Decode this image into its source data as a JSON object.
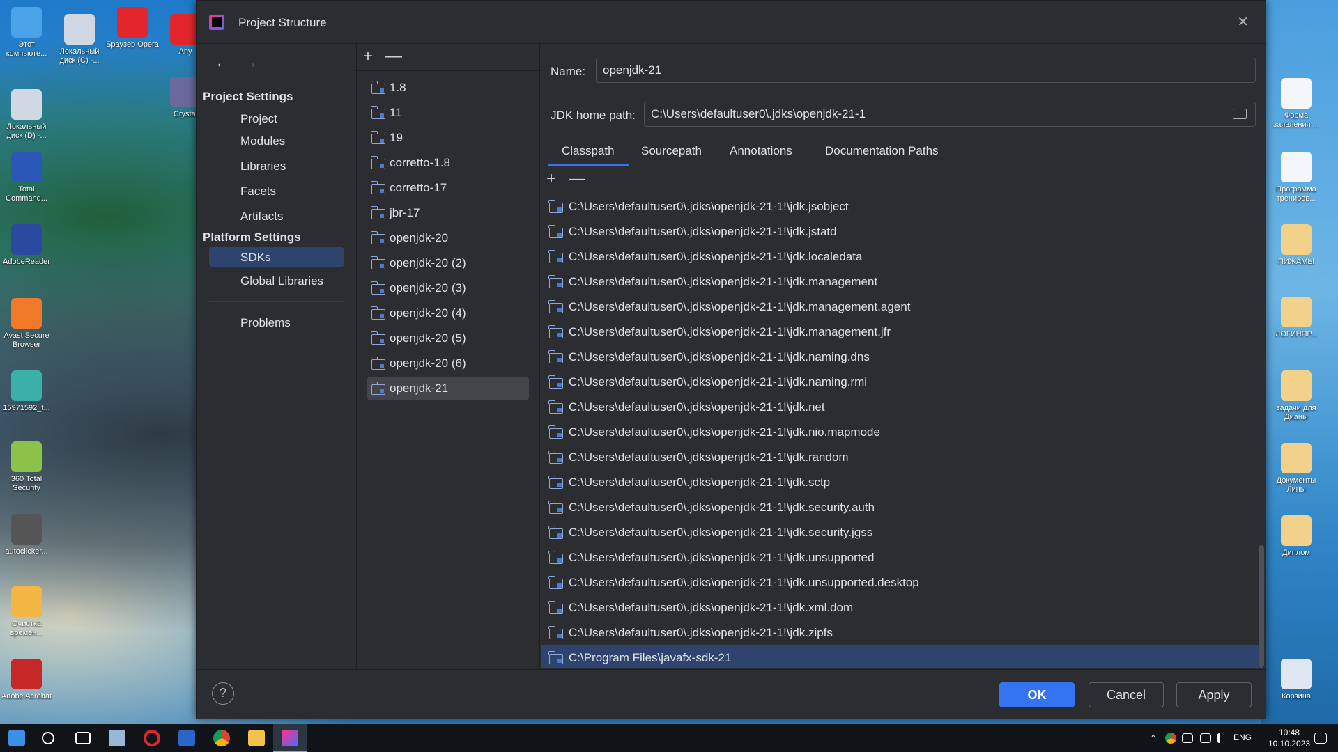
{
  "desktop": {
    "left_icons": [
      {
        "label": "Этот компьюте..."
      },
      {
        "label": "Локальный диск (C) -..."
      },
      {
        "label": "Браузер Opera"
      },
      {
        "label": "Any"
      },
      {
        "label": "Локальный диск (D) -..."
      },
      {
        "label": "Crystal"
      },
      {
        "label": "Total Command..."
      },
      {
        "label": "AdobeReader"
      },
      {
        "label": "Avast Secure Browser"
      },
      {
        "label": "15971592_t..."
      },
      {
        "label": "360 Total Security"
      },
      {
        "label": "autoclicker..."
      },
      {
        "label": "Очистка времен..."
      },
      {
        "label": "Adobe Acrobat"
      }
    ],
    "right_icons": [
      {
        "label": "Форма заявления ..."
      },
      {
        "label": "Программа трениров..."
      },
      {
        "label": "ПИЖАМЫ"
      },
      {
        "label": "ЛОГИНПР..."
      },
      {
        "label": "задачи для Дианы"
      },
      {
        "label": "Документы Лины"
      },
      {
        "label": "Диплом"
      },
      {
        "label": "Корзина"
      }
    ]
  },
  "window": {
    "title": "Project Structure",
    "close_glyph": "✕"
  },
  "nav": {
    "back_glyph": "←",
    "forward_glyph": "→",
    "project_settings_header": "Project Settings",
    "project_items": [
      "Project",
      "Modules",
      "Libraries",
      "Facets",
      "Artifacts"
    ],
    "platform_settings_header": "Platform Settings",
    "platform_items": [
      "SDKs",
      "Global Libraries"
    ],
    "problems": "Problems",
    "selected": "SDKs"
  },
  "sdks": {
    "add_glyph": "+",
    "remove_glyph": "—",
    "items": [
      "1.8",
      "11",
      "19",
      "corretto-1.8",
      "corretto-17",
      "jbr-17",
      "openjdk-20",
      "openjdk-20 (2)",
      "openjdk-20 (3)",
      "openjdk-20 (4)",
      "openjdk-20 (5)",
      "openjdk-20 (6)",
      "openjdk-21"
    ],
    "selected": "openjdk-21"
  },
  "detail": {
    "name_label": "Name:",
    "name_value": "openjdk-21",
    "home_label": "JDK home path:",
    "home_value": "C:\\Users\\defaultuser0\\.jdks\\openjdk-21-1",
    "tabs": [
      "Classpath",
      "Sourcepath",
      "Annotations",
      "Documentation Paths"
    ],
    "active_tab": "Classpath",
    "add_glyph": "+",
    "remove_glyph": "—",
    "paths": [
      "C:\\Users\\defaultuser0\\.jdks\\openjdk-21-1!\\jdk.jsobject",
      "C:\\Users\\defaultuser0\\.jdks\\openjdk-21-1!\\jdk.jstatd",
      "C:\\Users\\defaultuser0\\.jdks\\openjdk-21-1!\\jdk.localedata",
      "C:\\Users\\defaultuser0\\.jdks\\openjdk-21-1!\\jdk.management",
      "C:\\Users\\defaultuser0\\.jdks\\openjdk-21-1!\\jdk.management.agent",
      "C:\\Users\\defaultuser0\\.jdks\\openjdk-21-1!\\jdk.management.jfr",
      "C:\\Users\\defaultuser0\\.jdks\\openjdk-21-1!\\jdk.naming.dns",
      "C:\\Users\\defaultuser0\\.jdks\\openjdk-21-1!\\jdk.naming.rmi",
      "C:\\Users\\defaultuser0\\.jdks\\openjdk-21-1!\\jdk.net",
      "C:\\Users\\defaultuser0\\.jdks\\openjdk-21-1!\\jdk.nio.mapmode",
      "C:\\Users\\defaultuser0\\.jdks\\openjdk-21-1!\\jdk.random",
      "C:\\Users\\defaultuser0\\.jdks\\openjdk-21-1!\\jdk.sctp",
      "C:\\Users\\defaultuser0\\.jdks\\openjdk-21-1!\\jdk.security.auth",
      "C:\\Users\\defaultuser0\\.jdks\\openjdk-21-1!\\jdk.security.jgss",
      "C:\\Users\\defaultuser0\\.jdks\\openjdk-21-1!\\jdk.unsupported",
      "C:\\Users\\defaultuser0\\.jdks\\openjdk-21-1!\\jdk.unsupported.desktop",
      "C:\\Users\\defaultuser0\\.jdks\\openjdk-21-1!\\jdk.xml.dom",
      "C:\\Users\\defaultuser0\\.jdks\\openjdk-21-1!\\jdk.zipfs",
      "C:\\Program Files\\javafx-sdk-21"
    ],
    "selected_path": "C:\\Program Files\\javafx-sdk-21"
  },
  "footer": {
    "help_glyph": "?",
    "ok": "OK",
    "cancel": "Cancel",
    "apply": "Apply"
  },
  "taskbar": {
    "lang": "ENG",
    "time": "10:48",
    "date": "10.10.2023",
    "tray_up_glyph": "^"
  },
  "colors": {
    "accent": "#3574f0",
    "selection": "#2e436e",
    "window_bg": "#2b2d30"
  }
}
